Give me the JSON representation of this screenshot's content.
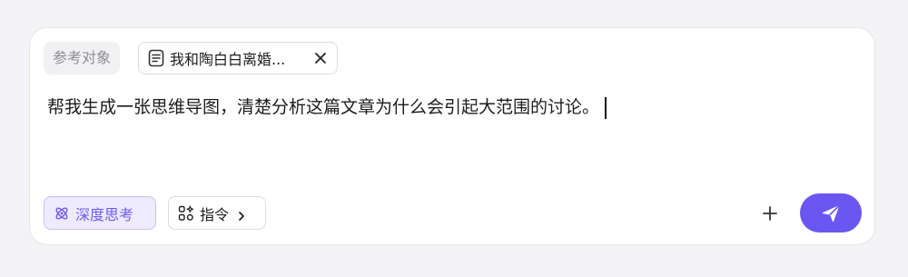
{
  "reference": {
    "label": "参考对象",
    "doc_title": "我和陶白白离婚...",
    "doc_icon": "document-icon",
    "remove_icon": "close-icon"
  },
  "input": {
    "text": "帮我生成一张思维导图，清楚分析这篇文章为什么会引起大范围的讨论。"
  },
  "toolbar": {
    "deep_think_label": "深度思考",
    "deep_think_icon": "atom-icon",
    "command_label": "指令",
    "command_icon": "apps-icon",
    "add_icon": "plus-icon",
    "send_icon": "send-icon"
  },
  "colors": {
    "accent": "#6a56f0",
    "accent_bg": "#eeeaff",
    "page_bg": "#f3f3f5"
  }
}
